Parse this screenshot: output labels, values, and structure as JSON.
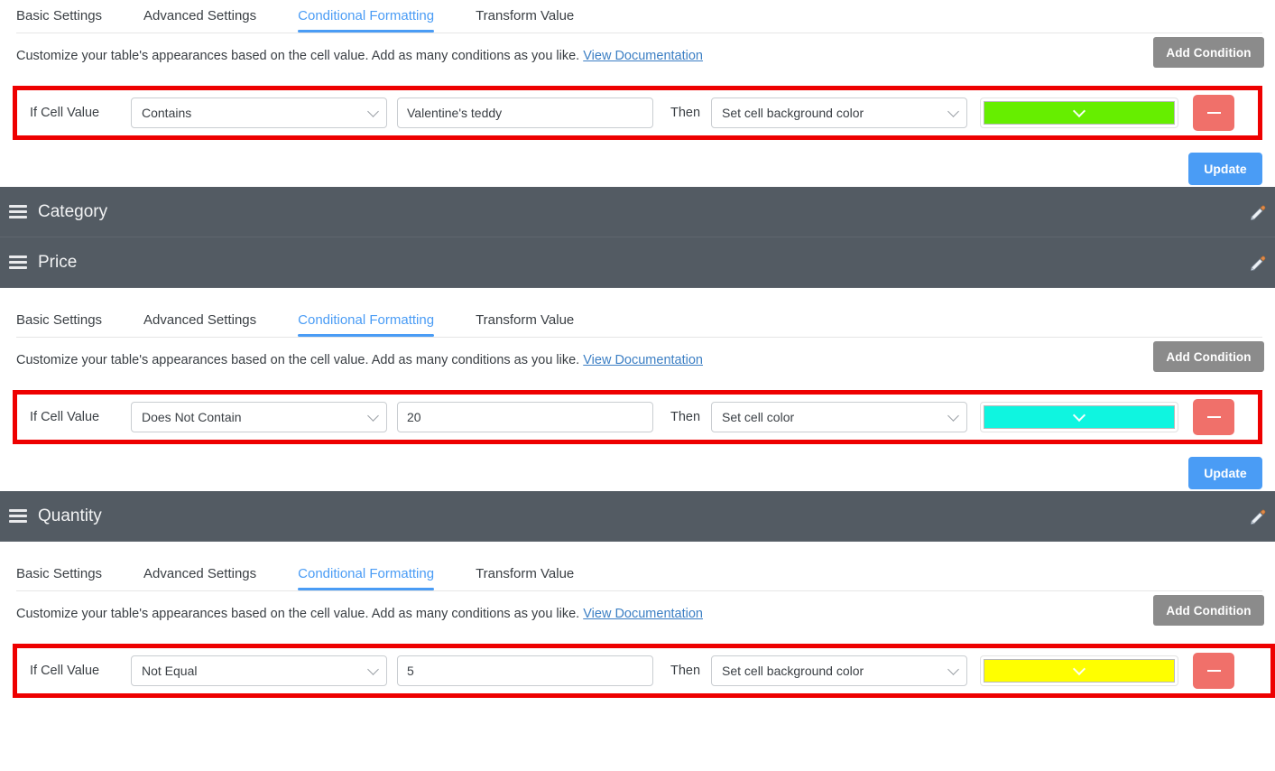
{
  "tabs": [
    {
      "label": "Basic Settings",
      "active": false
    },
    {
      "label": "Advanced Settings",
      "active": false
    },
    {
      "label": "Conditional Formatting",
      "active": true
    },
    {
      "label": "Transform Value",
      "active": false
    }
  ],
  "description": {
    "text": "Customize your table's appearances based on the cell value. Add as many conditions as you like.",
    "link": "View Documentation"
  },
  "buttons": {
    "add_condition": "Add Condition",
    "update": "Update",
    "add_condition_color": "#8b8b8b",
    "update_color": "#4a9cf5",
    "remove_color": "#f0706a"
  },
  "labels": {
    "if_cell_value": "If Cell Value",
    "then": "Then"
  },
  "highlight_color": "#ee0000",
  "accent_color": "#4a9cf5",
  "header_bg": "#535b63",
  "sections": [
    {
      "id": "section-top",
      "header": null,
      "condition": {
        "operator": "Contains",
        "value": "Valentine's teddy",
        "action": "Set cell background color",
        "color": "#66ee00"
      }
    },
    {
      "id": "section-category",
      "header": {
        "title": "Category"
      },
      "condition": null
    },
    {
      "id": "section-price",
      "header": {
        "title": "Price"
      },
      "condition": {
        "operator": "Does Not Contain",
        "value": "20",
        "action": "Set cell color",
        "color": "#0ff5e0"
      }
    },
    {
      "id": "section-quantity",
      "header": {
        "title": "Quantity"
      },
      "condition": {
        "operator": "Not Equal",
        "value": "5",
        "action": "Set cell background color",
        "color": "#ffff00"
      }
    }
  ]
}
